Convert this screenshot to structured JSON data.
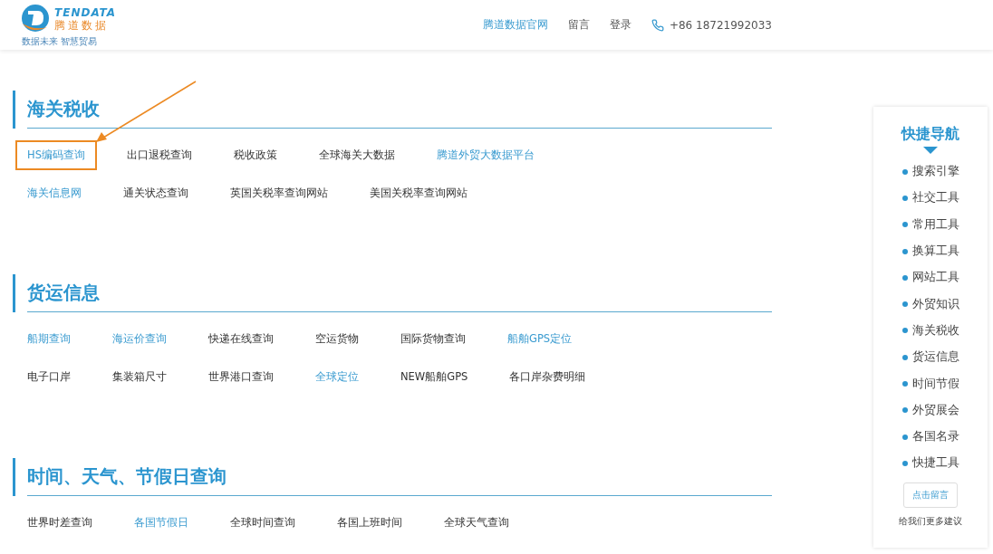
{
  "header": {
    "logo": {
      "name_en": "TENDATA",
      "name_cn": "腾道数据",
      "tagline": "数据未来 智慧贸易"
    },
    "nav": [
      {
        "label": "腾道数据官网",
        "selected": true
      },
      {
        "label": "留言",
        "selected": false
      },
      {
        "label": "登录",
        "selected": false
      }
    ],
    "phone": "+86 18721992033"
  },
  "sections": [
    {
      "title": "海关税收",
      "rows": [
        [
          {
            "label": "HS编码查询",
            "featured": true,
            "highlighted": true
          },
          {
            "label": "出口退税查询",
            "featured": false,
            "highlighted": false
          },
          {
            "label": "税收政策",
            "featured": false,
            "highlighted": false
          },
          {
            "label": "全球海关大数据",
            "featured": false,
            "highlighted": false
          },
          {
            "label": "腾道外贸大数据平台",
            "featured": true,
            "highlighted": false
          }
        ],
        [
          {
            "label": "海关信息网",
            "featured": true,
            "highlighted": false
          },
          {
            "label": "通关状态查询",
            "featured": false,
            "highlighted": false
          },
          {
            "label": "英国关税率查询网站",
            "featured": false,
            "highlighted": false
          },
          {
            "label": "美国关税率查询网站",
            "featured": false,
            "highlighted": false
          }
        ]
      ]
    },
    {
      "title": "货运信息",
      "rows": [
        [
          {
            "label": "船期查询",
            "featured": true,
            "highlighted": false
          },
          {
            "label": "海运价查询",
            "featured": true,
            "highlighted": false
          },
          {
            "label": "快递在线查询",
            "featured": false,
            "highlighted": false
          },
          {
            "label": "空运货物",
            "featured": false,
            "highlighted": false
          },
          {
            "label": "国际货物查询",
            "featured": false,
            "highlighted": false
          },
          {
            "label": "船舶GPS定位",
            "featured": true,
            "highlighted": false
          }
        ],
        [
          {
            "label": "电子口岸",
            "featured": false,
            "highlighted": false
          },
          {
            "label": "集装箱尺寸",
            "featured": false,
            "highlighted": false
          },
          {
            "label": "世界港口查询",
            "featured": false,
            "highlighted": false
          },
          {
            "label": "全球定位",
            "featured": true,
            "highlighted": false
          },
          {
            "label": "NEW船舶GPS",
            "featured": false,
            "highlighted": false
          },
          {
            "label": "各口岸杂费明细",
            "featured": false,
            "highlighted": false
          }
        ]
      ]
    },
    {
      "title": "时间、天气、节假日查询",
      "rows": [
        [
          {
            "label": "世界时差查询",
            "featured": false,
            "highlighted": false
          },
          {
            "label": "各国节假日",
            "featured": true,
            "highlighted": false
          },
          {
            "label": "全球时间查询",
            "featured": false,
            "highlighted": false
          },
          {
            "label": "各国上班时间",
            "featured": false,
            "highlighted": false
          },
          {
            "label": "全球天气查询",
            "featured": false,
            "highlighted": false
          }
        ]
      ]
    }
  ],
  "quick_nav": {
    "title": "快捷导航",
    "items": [
      "搜索引擎",
      "社交工具",
      "常用工具",
      "换算工具",
      "网站工具",
      "外贸知识",
      "海关税收",
      "货运信息",
      "时间节假",
      "外贸展会",
      "各国名录",
      "快捷工具"
    ],
    "button": "点击留言",
    "note": "给我们更多建议"
  }
}
